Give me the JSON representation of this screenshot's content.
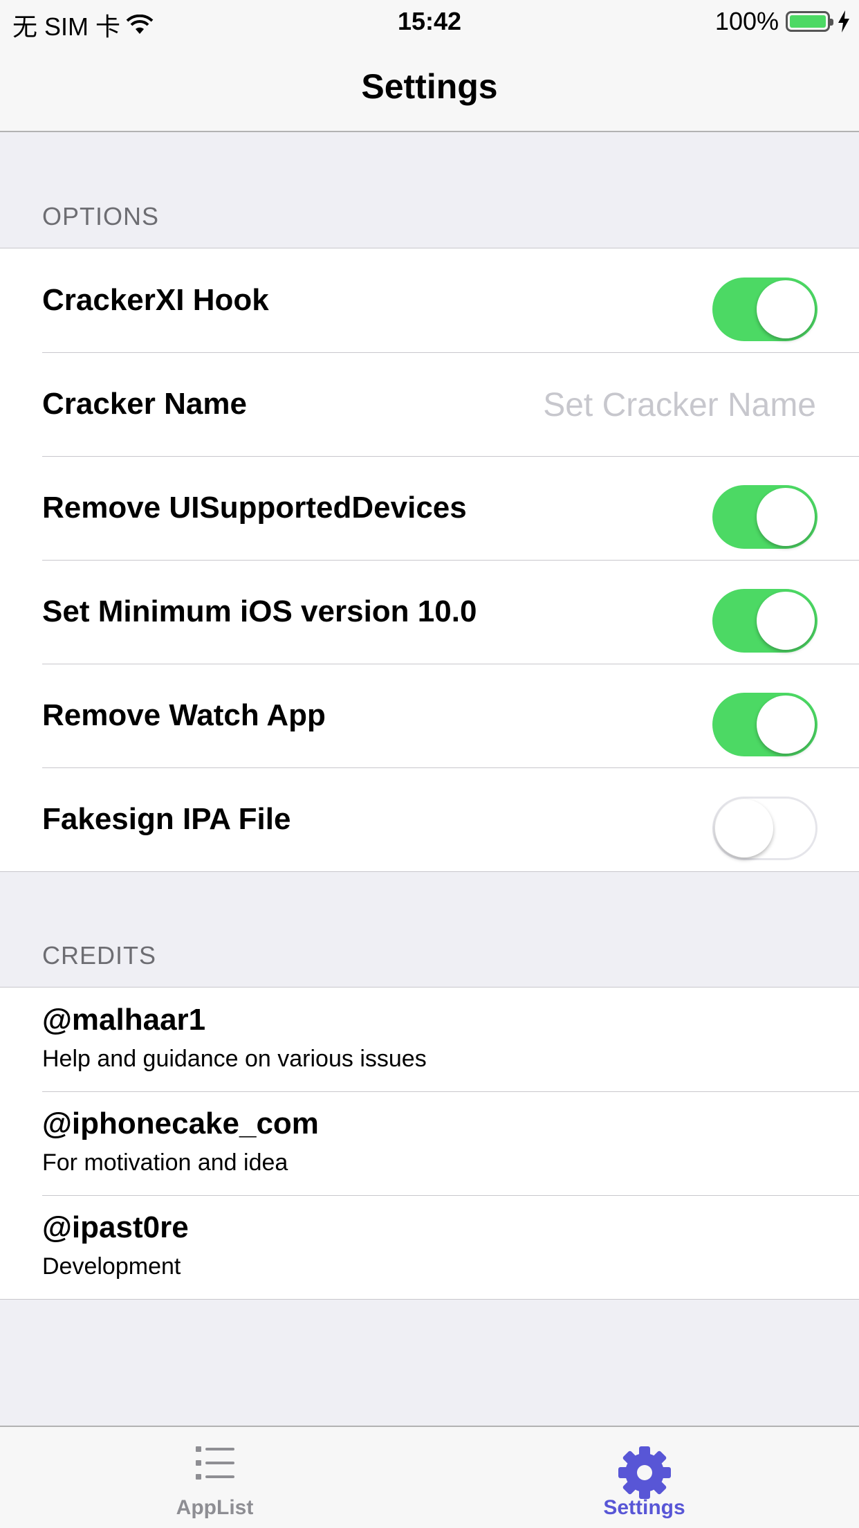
{
  "status_bar": {
    "carrier": "无 SIM 卡",
    "time": "15:42",
    "battery": "100%",
    "battery_level": 1.0
  },
  "nav": {
    "title": "Settings"
  },
  "options": {
    "header": "OPTIONS",
    "rows": [
      {
        "label": "CrackerXI Hook",
        "type": "switch",
        "on": true
      },
      {
        "label": "Cracker Name",
        "type": "input",
        "placeholder": "Set Cracker Name",
        "value": ""
      },
      {
        "label": "Remove UISupportedDevices",
        "type": "switch",
        "on": true
      },
      {
        "label": "Set Minimum iOS version 10.0",
        "type": "switch",
        "on": true
      },
      {
        "label": "Remove Watch App",
        "type": "switch",
        "on": true
      },
      {
        "label": "Fakesign IPA File",
        "type": "switch",
        "on": false
      }
    ]
  },
  "credits": {
    "header": "CREDITS",
    "items": [
      {
        "title": "@malhaar1",
        "subtitle": "Help and guidance on various issues"
      },
      {
        "title": "@iphonecake_com",
        "subtitle": "For motivation and idea"
      },
      {
        "title": "@ipast0re",
        "subtitle": "Development"
      }
    ]
  },
  "tabbar": {
    "tabs": [
      {
        "label": "AppList",
        "icon": "list-icon",
        "selected": false
      },
      {
        "label": "Settings",
        "icon": "gear-icon",
        "selected": true
      }
    ]
  },
  "colors": {
    "accent": "#5856d6",
    "switch_on": "#4cd964",
    "inactive_tab": "#8e8e93",
    "background": "#efeff4"
  }
}
